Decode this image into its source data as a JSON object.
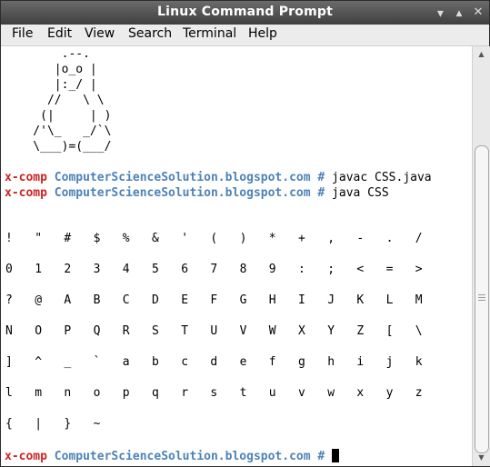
{
  "window": {
    "title": "Linux Command Prompt",
    "controls": {
      "minimize": "▲",
      "maximize": "▲",
      "close": "✕"
    }
  },
  "menu": {
    "items": [
      "File",
      "Edit",
      "View",
      "Search",
      "Terminal",
      "Help"
    ]
  },
  "terminal": {
    "ascii_art": [
      "        .--.",
      "       |o_o |",
      "       |:_/ |",
      "      //   \\ \\",
      "     (|     | )",
      "    /'\\_   _/`\\",
      "    \\___)=(___/"
    ],
    "prompt": {
      "user": "x-comp",
      "host": "ComputerScienceSolution.blogspot.com",
      "symbol": "#"
    },
    "commands": [
      "javac CSS.java",
      "java CSS"
    ],
    "output_rows": [
      [
        "!",
        "\"",
        "#",
        "$",
        "%",
        "&",
        "'",
        "(",
        ")",
        "*",
        "+",
        ",",
        "-",
        ".",
        "/"
      ],
      [
        "0",
        "1",
        "2",
        "3",
        "4",
        "5",
        "6",
        "7",
        "8",
        "9",
        ":",
        ";",
        "<",
        "=",
        ">"
      ],
      [
        "?",
        "@",
        "A",
        "B",
        "C",
        "D",
        "E",
        "F",
        "G",
        "H",
        "I",
        "J",
        "K",
        "L",
        "M"
      ],
      [
        "N",
        "O",
        "P",
        "Q",
        "R",
        "S",
        "T",
        "U",
        "V",
        "W",
        "X",
        "Y",
        "Z",
        "[",
        "\\"
      ],
      [
        "]",
        "^",
        "_",
        "`",
        "a",
        "b",
        "c",
        "d",
        "e",
        "f",
        "g",
        "h",
        "i",
        "j",
        "k"
      ],
      [
        "l",
        "m",
        "n",
        "o",
        "p",
        "q",
        "r",
        "s",
        "t",
        "u",
        "v",
        "w",
        "x",
        "y",
        "z"
      ],
      [
        "{",
        "|",
        "}",
        "~"
      ]
    ]
  },
  "colors": {
    "prompt_user": "#cc2424",
    "prompt_host": "#4d82b8",
    "titlebar": "#4a4a4a"
  }
}
